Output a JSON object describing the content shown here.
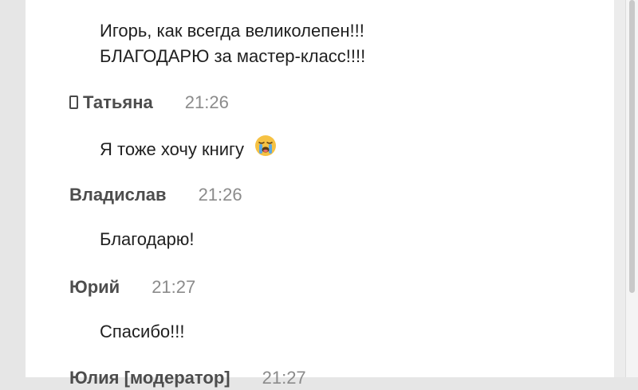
{
  "chat": {
    "messages": [
      {
        "lines": [
          "Игорь, как всегда великолепен!!!",
          "БЛАГОДАРЮ за мастер-класс!!!!"
        ]
      },
      {
        "author": "Татьяна",
        "time": "21:26",
        "device_icon": "mobile-phone-icon",
        "text": "Я тоже хочу книгу",
        "emoji": "loudly-crying-face-emoji"
      },
      {
        "author": "Владислав",
        "time": "21:26",
        "text": "Благодарю!"
      },
      {
        "author": "Юрий",
        "time": "21:27",
        "text": "Спасибо!!!"
      },
      {
        "author": "Юлия [модератор]",
        "time": "21:27"
      }
    ]
  },
  "colors": {
    "background": "#e6e6e6",
    "panel": "#ffffff",
    "author": "#4d4d4d",
    "time": "#8b8b8b",
    "text": "#1f1f1f",
    "emoji": "#f6c243"
  }
}
